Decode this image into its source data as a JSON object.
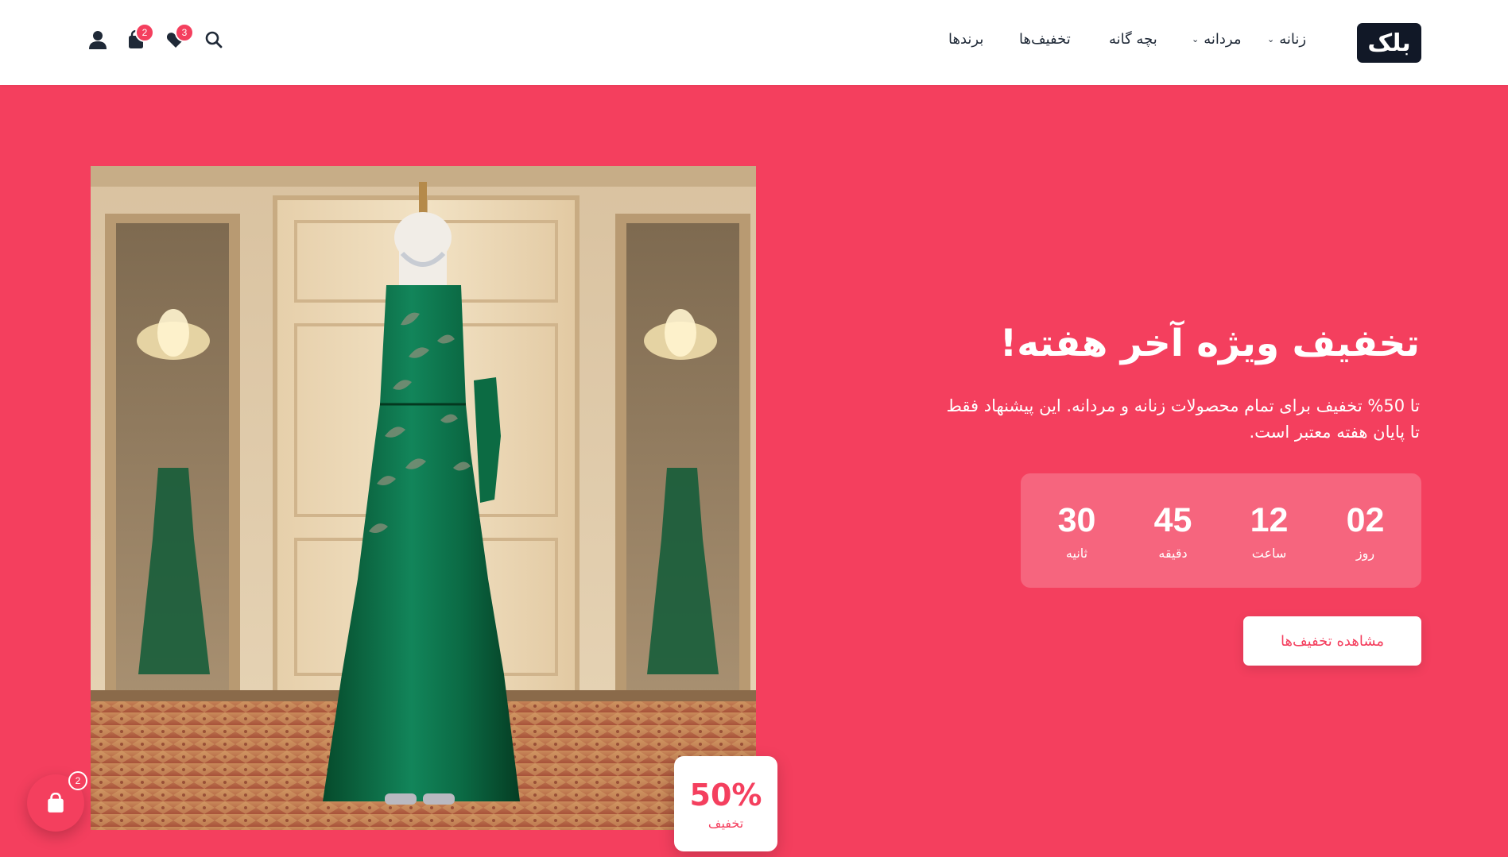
{
  "header": {
    "logo": "بلک",
    "nav": [
      {
        "label": "زنانه",
        "has_dropdown": true
      },
      {
        "label": "مردانه",
        "has_dropdown": true
      },
      {
        "label": "بچه گانه",
        "has_dropdown": false
      },
      {
        "label": "تخفیف‌ها",
        "has_dropdown": false
      },
      {
        "label": "برندها",
        "has_dropdown": false
      }
    ],
    "icons": {
      "search": "search-icon",
      "wishlist": "heart-icon",
      "cart": "shopping-bag-icon",
      "account": "user-icon"
    },
    "wishlist_count": "3",
    "cart_count": "2"
  },
  "hero": {
    "title": "تخفیف ویژه آخر هفته!",
    "description": "تا 50% تخفیف برای تمام محصولات زنانه و مردانه. این پیشنهاد فقط تا پایان هفته معتبر است.",
    "countdown": [
      {
        "value": "02",
        "label": "روز"
      },
      {
        "value": "12",
        "label": "ساعت"
      },
      {
        "value": "45",
        "label": "دقیقه"
      },
      {
        "value": "30",
        "label": "ثانیه"
      }
    ],
    "cta_label": "مشاهده تخفیف‌ها",
    "discount_badge": {
      "percent": "50%",
      "label": "تخفیف"
    }
  },
  "floating_cart": {
    "count": "2",
    "icon": "shopping-bag-icon"
  },
  "colors": {
    "brand": "#f43f5e",
    "dark": "#111827",
    "dress": "#0b6b3f"
  }
}
